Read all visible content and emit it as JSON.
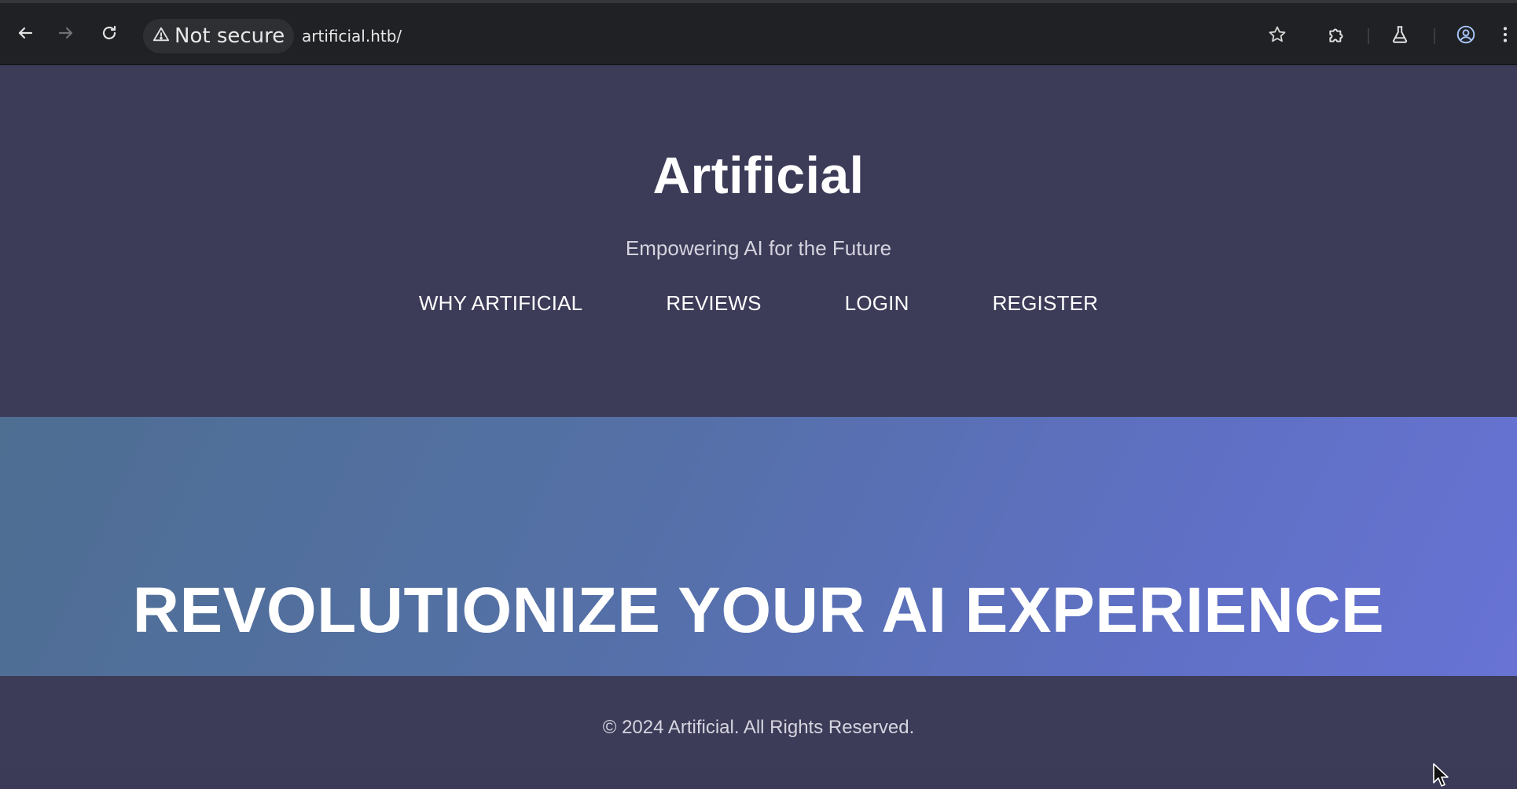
{
  "browser": {
    "security_label": "Not secure",
    "url": "artificial.htb/",
    "icons": {
      "back": "back-arrow-icon",
      "forward": "forward-arrow-icon",
      "reload": "reload-icon",
      "security": "warning-triangle-icon",
      "bookmark": "star-icon",
      "extensions": "puzzle-icon",
      "labs": "flask-icon",
      "profile": "profile-icon",
      "menu": "kebab-menu-icon"
    }
  },
  "header": {
    "title": "Artificial",
    "tagline": "Empowering AI for the Future",
    "nav": [
      {
        "label": "WHY ARTIFICIAL"
      },
      {
        "label": "REVIEWS"
      },
      {
        "label": "LOGIN"
      },
      {
        "label": "REGISTER"
      }
    ]
  },
  "hero": {
    "heading": "REVOLUTIONIZE YOUR AI EXPERIENCE"
  },
  "footer": {
    "copyright": "© 2024 Artificial. All Rights Reserved."
  },
  "colors": {
    "header_bg": "#3c3b58",
    "hero_gradient_start": "#4e6e92",
    "hero_gradient_end": "#6873d4",
    "chrome_bg": "#202124",
    "text_light": "#ffffff"
  }
}
